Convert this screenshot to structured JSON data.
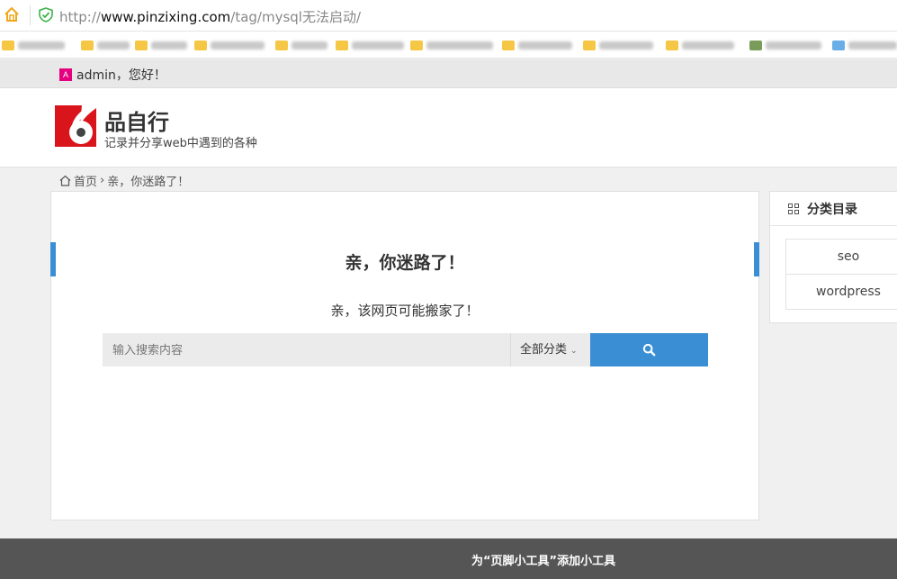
{
  "browser": {
    "url_prefix": "http://",
    "url_host": "www.pinzixing.com",
    "url_path": "/tag/mysql无法启动/"
  },
  "userbar": {
    "avatar_letter": "A",
    "greeting": "admin，您好！"
  },
  "header": {
    "site_title": "品自行",
    "site_desc": "记录并分享web中遇到的各种"
  },
  "breadcrumb": {
    "home": "首页",
    "separator": "›",
    "current": "亲，你迷路了！"
  },
  "main": {
    "heading": "亲，你迷路了！",
    "message": "亲，该网页可能搬家了！",
    "search": {
      "placeholder": "输入搜索内容",
      "category": "全部分类",
      "category_chevron": "⌄",
      "button_icon": "search-icon"
    }
  },
  "sidebar": {
    "title": "分类目录",
    "categories": [
      "seo",
      "wordpress"
    ]
  },
  "footer": {
    "text": "为“页脚小工具”添加小工具"
  },
  "colors": {
    "accent": "#3a8fd4",
    "footer_bg": "#555555",
    "avatar": "#e5007f",
    "logo_red": "#d9151b"
  }
}
